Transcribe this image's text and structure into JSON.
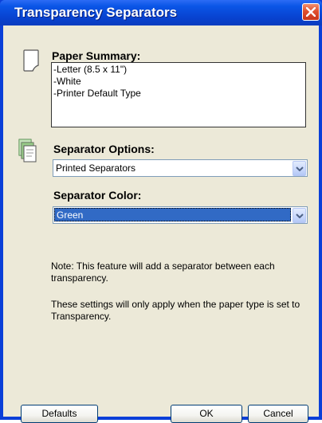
{
  "window": {
    "title": "Transparency Separators"
  },
  "paper_summary": {
    "label": "Paper Summary:",
    "lines": [
      "-Letter (8.5 x 11\")",
      "-White",
      "-Printer Default Type"
    ]
  },
  "separator_options": {
    "label": "Separator Options:",
    "selected": "Printed Separators"
  },
  "separator_color": {
    "label": "Separator Color:",
    "selected": "Green"
  },
  "notes": {
    "note1": "Note: This feature will add a separator between each transparency.",
    "note2": "These settings will only apply when the paper type is set to Transparency."
  },
  "buttons": {
    "defaults": "Defaults",
    "ok": "OK",
    "cancel": "Cancel"
  },
  "icons": {
    "close": "close-icon",
    "paper": "paper-icon",
    "separator": "separator-stack-icon",
    "dropdown": "chevron-down-icon"
  },
  "colors": {
    "title_bar": "#0a55e6",
    "client_bg": "#ece9d8",
    "selection": "#316ac5",
    "close_button": "#e0502e"
  }
}
